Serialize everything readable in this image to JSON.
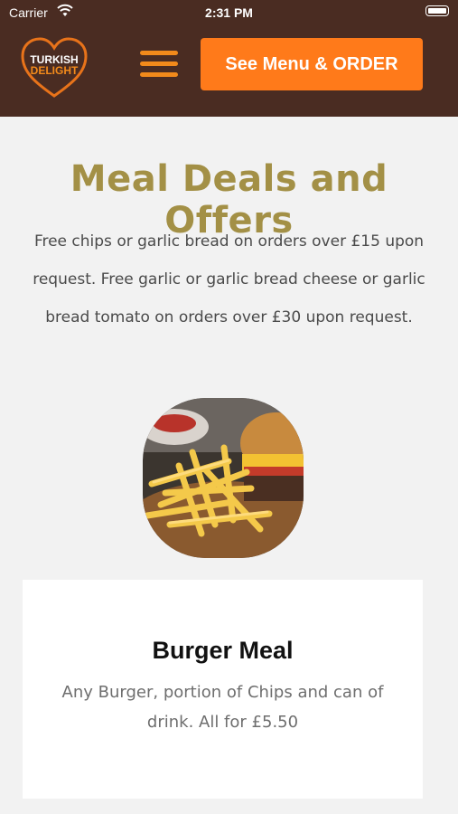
{
  "status_bar": {
    "carrier": "Carrier",
    "time": "2:31 PM"
  },
  "header": {
    "logo_text_line1": "TURKISH",
    "logo_text_line2": "DELIGHT",
    "menu_icon": "hamburger-menu-icon",
    "order_button_label": "See Menu & ORDER"
  },
  "main": {
    "title": "Meal Deals and Offers",
    "intro": "Free chips or garlic bread on orders over £15 upon request. Free garlic or garlic bread cheese or garlic bread tomato on orders over £30 upon request."
  },
  "offer": {
    "title": "Burger Meal",
    "description": "Any Burger, portion of Chips and can of drink. All for £5.50"
  },
  "colors": {
    "header_bg": "#4a2c22",
    "accent_orange": "#ff7a1a",
    "title_gold": "#a39046"
  }
}
